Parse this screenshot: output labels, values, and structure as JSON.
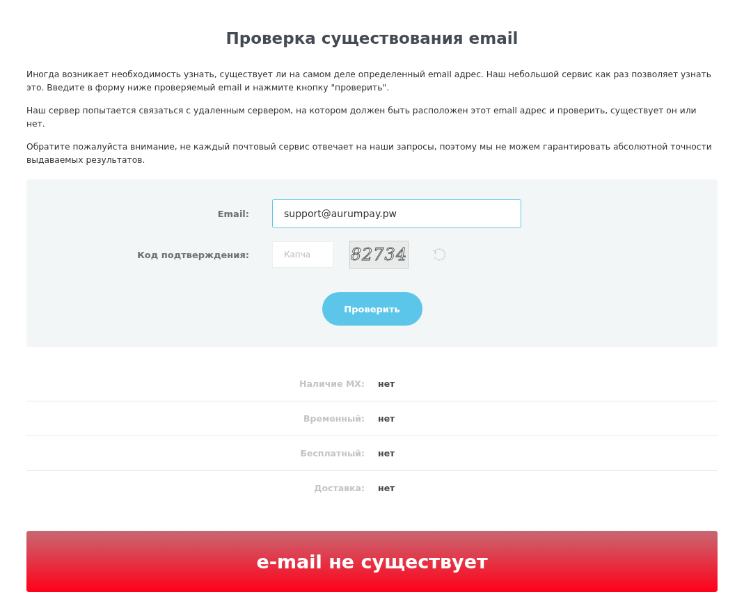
{
  "title": "Проверка существования email",
  "paragraphs": [
    "Иногда возникает необходимость узнать, существует ли на самом деле определенный email адрес. Наш небольшой сервис как раз позволяет узнать это. Введите в форму ниже проверяемый email и нажмите кнопку \"проверить\".",
    "Наш сервер попытается связаться с удаленным сервером, на котором должен быть расположен этот email адрес и проверить, существует он или нет.",
    "Обратите пожалуйста внимание, не каждый почтовый сервис отвечает на наши запросы, поэтому мы не можем гарантировать абсолютной точности выдаваемых результатов."
  ],
  "form": {
    "email_label": "Email:",
    "email_value": "support@aurumpay.pw",
    "email_focused": true,
    "captcha_label": "Код подтверждения:",
    "captcha_placeholder": "Капча",
    "captcha_code": "82734",
    "submit": "Проверить"
  },
  "results": [
    {
      "label": "Наличие MX:",
      "value": "нет"
    },
    {
      "label": "Временный:",
      "value": "нет"
    },
    {
      "label": "Бесплатный:",
      "value": "нет"
    },
    {
      "label": "Доставка:",
      "value": "нет"
    }
  ],
  "verdict": {
    "text": "e-mail не существует",
    "exists": false
  }
}
